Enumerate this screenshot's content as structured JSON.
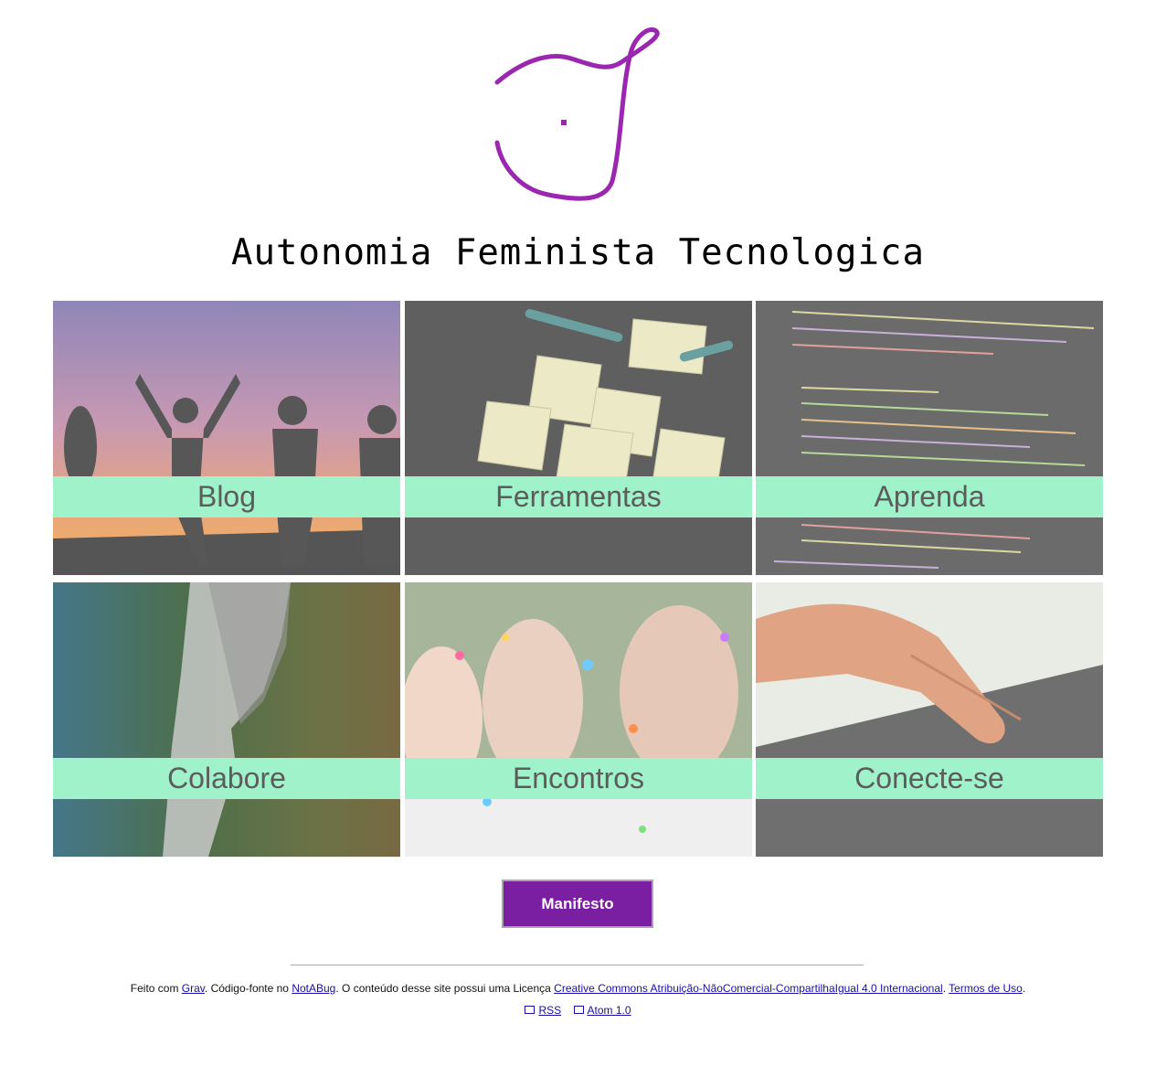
{
  "site": {
    "title": "Autonomia Feminista Tecnologica",
    "brand_color": "#9b27b0",
    "accent_band_color": "#9ff2c9"
  },
  "tiles": [
    {
      "label": "Blog",
      "image": "silhouettes-sunset"
    },
    {
      "label": "Ferramentas",
      "image": "sticky-notes"
    },
    {
      "label": "Aprenda",
      "image": "code-screen"
    },
    {
      "label": "Colabore",
      "image": "binary-face"
    },
    {
      "label": "Encontros",
      "image": "confetti-women"
    },
    {
      "label": "Conecte-se",
      "image": "hand-keyboard"
    }
  ],
  "manifesto": {
    "label": "Manifesto",
    "color": "#7a1fa2"
  },
  "footer": {
    "t1": "Feito com ",
    "grav": "Grav",
    "t2": ". Código-fonte no ",
    "notabug": "NotABug",
    "t3": ". O conteúdo desse site possui uma Licença ",
    "license": "Creative Commons Atribuição-NãoComercial-CompartilhaIgual 4.0 Internacional",
    "t4": ". ",
    "terms": "Termos de Uso",
    "t5": ".",
    "rss": "RSS",
    "atom": "Atom 1.0"
  }
}
